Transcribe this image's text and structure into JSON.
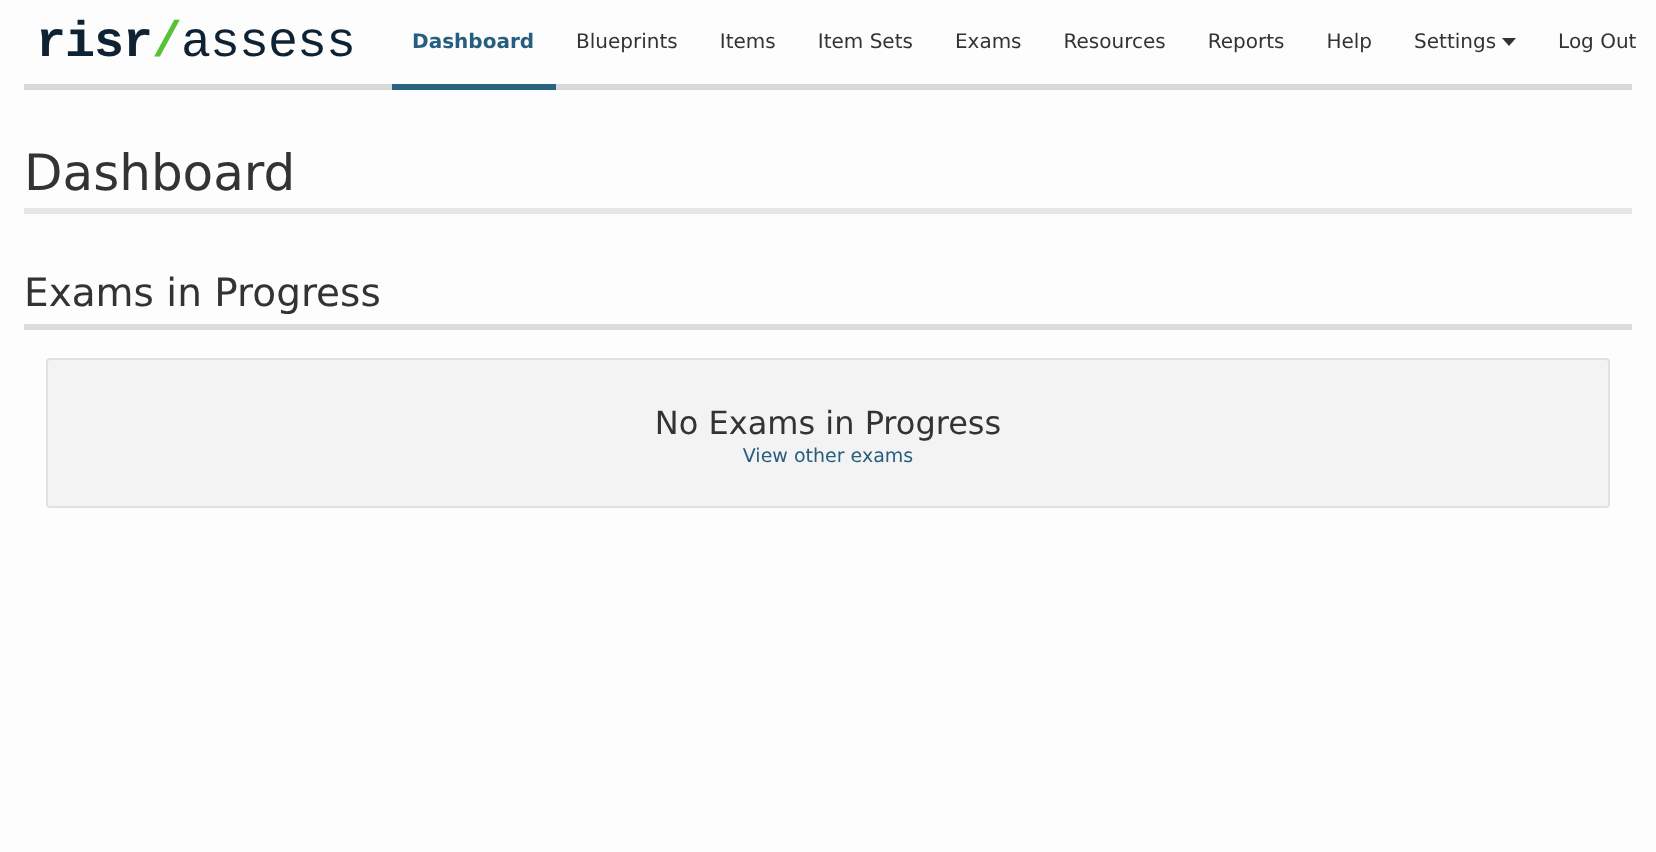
{
  "logo": {
    "brand": "risr",
    "separator": "/",
    "product": "assess"
  },
  "nav": [
    {
      "label": "Dashboard",
      "selected": true,
      "kind": "link"
    },
    {
      "label": "Blueprints",
      "selected": false,
      "kind": "link"
    },
    {
      "label": "Items",
      "selected": false,
      "kind": "link"
    },
    {
      "label": "Item Sets",
      "selected": false,
      "kind": "link"
    },
    {
      "label": "Exams",
      "selected": false,
      "kind": "link"
    },
    {
      "label": "Resources",
      "selected": false,
      "kind": "link"
    },
    {
      "label": "Reports",
      "selected": false,
      "kind": "link"
    },
    {
      "label": "Help",
      "selected": false,
      "kind": "link"
    },
    {
      "label": "Settings",
      "selected": false,
      "kind": "dropdown"
    }
  ],
  "logout": "Log Out",
  "page_title": "Dashboard",
  "section": {
    "title": "Exams in Progress",
    "empty_message": "No Exams in Progress",
    "link": "View other exams"
  }
}
